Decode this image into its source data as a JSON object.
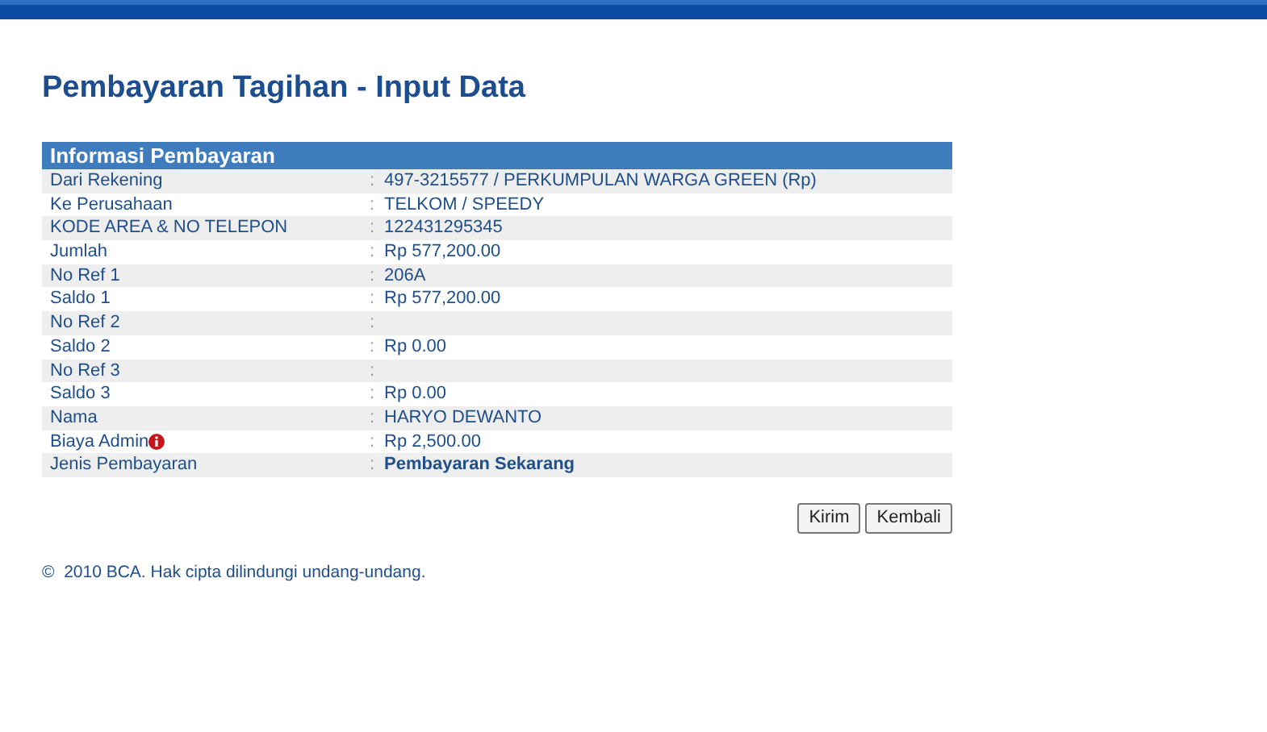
{
  "page_title": "Pembayaran Tagihan - Input Data",
  "table": {
    "header": "Informasi Pembayaran",
    "rows": [
      {
        "label": "Dari Rekening",
        "colon": ":",
        "value": "497-3215577 / PERKUMPULAN WARGA GREEN (Rp)",
        "info": false,
        "emphasis": false
      },
      {
        "label": "Ke Perusahaan",
        "colon": ":",
        "value": "TELKOM / SPEEDY",
        "info": false,
        "emphasis": false
      },
      {
        "label": "KODE AREA & NO TELEPON",
        "colon": ":",
        "value": "122431295345",
        "info": false,
        "emphasis": false
      },
      {
        "label": "Jumlah",
        "colon": ":",
        "value": "Rp 577,200.00",
        "info": false,
        "emphasis": false
      },
      {
        "label": "No Ref 1",
        "colon": ":",
        "value": "206A",
        "info": false,
        "emphasis": false
      },
      {
        "label": "Saldo 1",
        "colon": ":",
        "value": "Rp 577,200.00",
        "info": false,
        "emphasis": false
      },
      {
        "label": "No Ref 2",
        "colon": ":",
        "info": false
      },
      {
        "label": "Saldo 2",
        "colon": ":",
        "value": "Rp 0.00",
        "info": false,
        "emphasis": false
      },
      {
        "label": "No Ref 3",
        "colon": ":",
        "info": false
      },
      {
        "label": "Saldo 3",
        "colon": ":",
        "value": "Rp 0.00",
        "info": false,
        "emphasis": false
      },
      {
        "label": "Nama",
        "colon": ":",
        "value": "HARYO DEWANTO",
        "info": false,
        "emphasis": false
      },
      {
        "label": "Biaya Admin",
        "colon": ":",
        "value": "Rp 2,500.00",
        "info": true,
        "emphasis": false
      },
      {
        "label": "Jenis Pembayaran",
        "colon": ":",
        "value": "Pembayaran Sekarang",
        "info": false,
        "emphasis": true
      }
    ]
  },
  "buttons": [
    "Kirim",
    "Kembali"
  ],
  "footer": "©  2010 BCA. Hak cipta dilindungi undang-undang."
}
